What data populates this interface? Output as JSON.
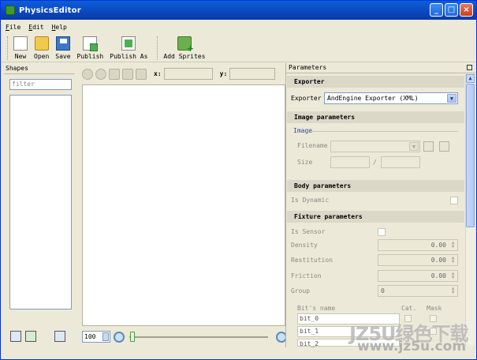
{
  "window": {
    "title": "PhysicsEditor"
  },
  "menu": {
    "items": [
      {
        "accel": "F",
        "rest": "ile"
      },
      {
        "accel": "E",
        "rest": "dit"
      },
      {
        "accel": "H",
        "rest": "elp"
      }
    ]
  },
  "toolbar": {
    "items": [
      {
        "label": "New",
        "icon": "new-document-icon"
      },
      {
        "label": "Open",
        "icon": "open-folder-icon"
      },
      {
        "label": "Save",
        "icon": "save-disk-icon"
      },
      {
        "label": "Publish",
        "icon": "publish-icon"
      },
      {
        "label": "Publish As",
        "icon": "publish-as-icon"
      },
      {
        "label": "Add Sprites",
        "icon": "add-sprites-icon"
      }
    ]
  },
  "shapes": {
    "title": "Shapes",
    "filter_placeholder": "filter"
  },
  "canvas": {
    "x_label": "x:",
    "y_label": "y:",
    "zoom": "100"
  },
  "parameters": {
    "title": "Parameters",
    "exporter": {
      "header": "Exporter",
      "label": "Exporter",
      "value": "AndEngine Exporter (XML)"
    },
    "image": {
      "header": "Image parameters",
      "group": "Image",
      "filename_label": "Filename",
      "size_label": "Size",
      "size_sep": "/"
    },
    "body": {
      "header": "Body parameters",
      "is_dynamic_label": "Is Dynamic"
    },
    "fixture": {
      "header": "Fixture parameters",
      "is_sensor_label": "Is Sensor",
      "density_label": "Density",
      "density": "0.00",
      "restitution_label": "Restitution",
      "restitution": "0.00",
      "friction_label": "Friction",
      "friction": "0.00",
      "group_label": "Group",
      "group": "0",
      "bits_header": "Bit's name",
      "cat_header": "Cat.",
      "mask_header": "Mask",
      "bits": [
        "bit_0",
        "bit_1",
        "bit_2"
      ]
    }
  },
  "watermark": {
    "text": "JZ5U绿色下载",
    "url": "www.jz5u.com"
  }
}
